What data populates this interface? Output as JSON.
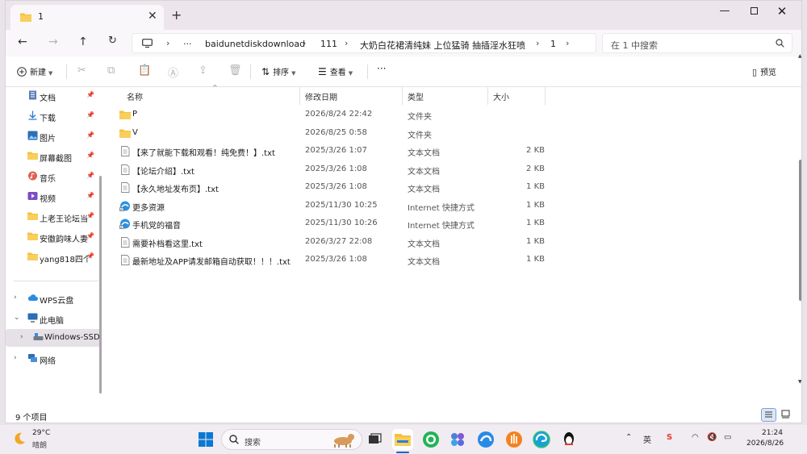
{
  "tab": {
    "title": "1",
    "close": "✕",
    "new": "+"
  },
  "window_controls": {
    "minimize": "—",
    "close": "✕"
  },
  "address": {
    "more": "···",
    "crumbs": [
      "baidunetdiskdownload",
      "111",
      "大奶白花裙清纯妹 上位猛骑 抽插淫水狂喷",
      "1"
    ],
    "sep": "›"
  },
  "search": {
    "placeholder": "在 1 中搜索"
  },
  "commands": {
    "new": "新建",
    "sort": "排序",
    "view": "查看",
    "more": "···",
    "preview": "预览"
  },
  "sidebar": {
    "items": [
      {
        "label": "文档",
        "icon": "document-icon",
        "pinned": true
      },
      {
        "label": "下载",
        "icon": "download-icon",
        "pinned": true
      },
      {
        "label": "图片",
        "icon": "picture-icon",
        "pinned": true
      },
      {
        "label": "屏幕截图",
        "icon": "folder-icon",
        "pinned": true
      },
      {
        "label": "音乐",
        "icon": "music-icon",
        "pinned": true
      },
      {
        "label": "视频",
        "icon": "video-icon",
        "pinned": true
      },
      {
        "label": "上老王论坛当",
        "icon": "folder-icon",
        "pinned": true
      },
      {
        "label": "安徽韵味人妻",
        "icon": "folder-icon",
        "pinned": true
      },
      {
        "label": "yang818四个",
        "icon": "folder-icon",
        "pinned": true
      }
    ],
    "wps": "WPS云盘",
    "this_pc": "此电脑",
    "drive": "Windows-SSD",
    "network": "网络"
  },
  "columns": {
    "name": "名称",
    "modified": "修改日期",
    "type": "类型",
    "size": "大小"
  },
  "files": [
    {
      "name": "P",
      "modified": "2026/8/24 22:42",
      "type": "文件夹",
      "size": "",
      "icon": "folder"
    },
    {
      "name": "V",
      "modified": "2026/8/25 0:58",
      "type": "文件夹",
      "size": "",
      "icon": "folder"
    },
    {
      "name": "【来了就能下载和观看！纯免费！】.txt",
      "modified": "2025/3/26 1:07",
      "type": "文本文档",
      "size": "2 KB",
      "icon": "text"
    },
    {
      "name": "【论坛介绍】.txt",
      "modified": "2025/3/26 1:08",
      "type": "文本文档",
      "size": "2 KB",
      "icon": "text"
    },
    {
      "name": "【永久地址发布页】.txt",
      "modified": "2025/3/26 1:08",
      "type": "文本文档",
      "size": "1 KB",
      "icon": "text"
    },
    {
      "name": "更多资源",
      "modified": "2025/11/30 10:25",
      "type": "Internet 快捷方式",
      "size": "1 KB",
      "icon": "shortcut"
    },
    {
      "name": "手机党的福音",
      "modified": "2025/11/30 10:26",
      "type": "Internet 快捷方式",
      "size": "1 KB",
      "icon": "shortcut"
    },
    {
      "name": "需要补档看这里.txt",
      "modified": "2026/3/27 22:08",
      "type": "文本文档",
      "size": "1 KB",
      "icon": "text"
    },
    {
      "name": "最新地址及APP请发邮箱自动获取！！！.txt",
      "modified": "2025/3/26 1:08",
      "type": "文本文档",
      "size": "1 KB",
      "icon": "text"
    }
  ],
  "status": {
    "count": "9 个项目"
  },
  "taskbar": {
    "weather_temp": "29°C",
    "weather_desc": "晴朗",
    "search_label": "搜索",
    "tray_ime": "英",
    "time": "21:24",
    "date": "2026/8/26"
  },
  "colors": {
    "folder": "#f4c042",
    "accent": "#0a64c8",
    "selected": "#e5e1e6"
  }
}
